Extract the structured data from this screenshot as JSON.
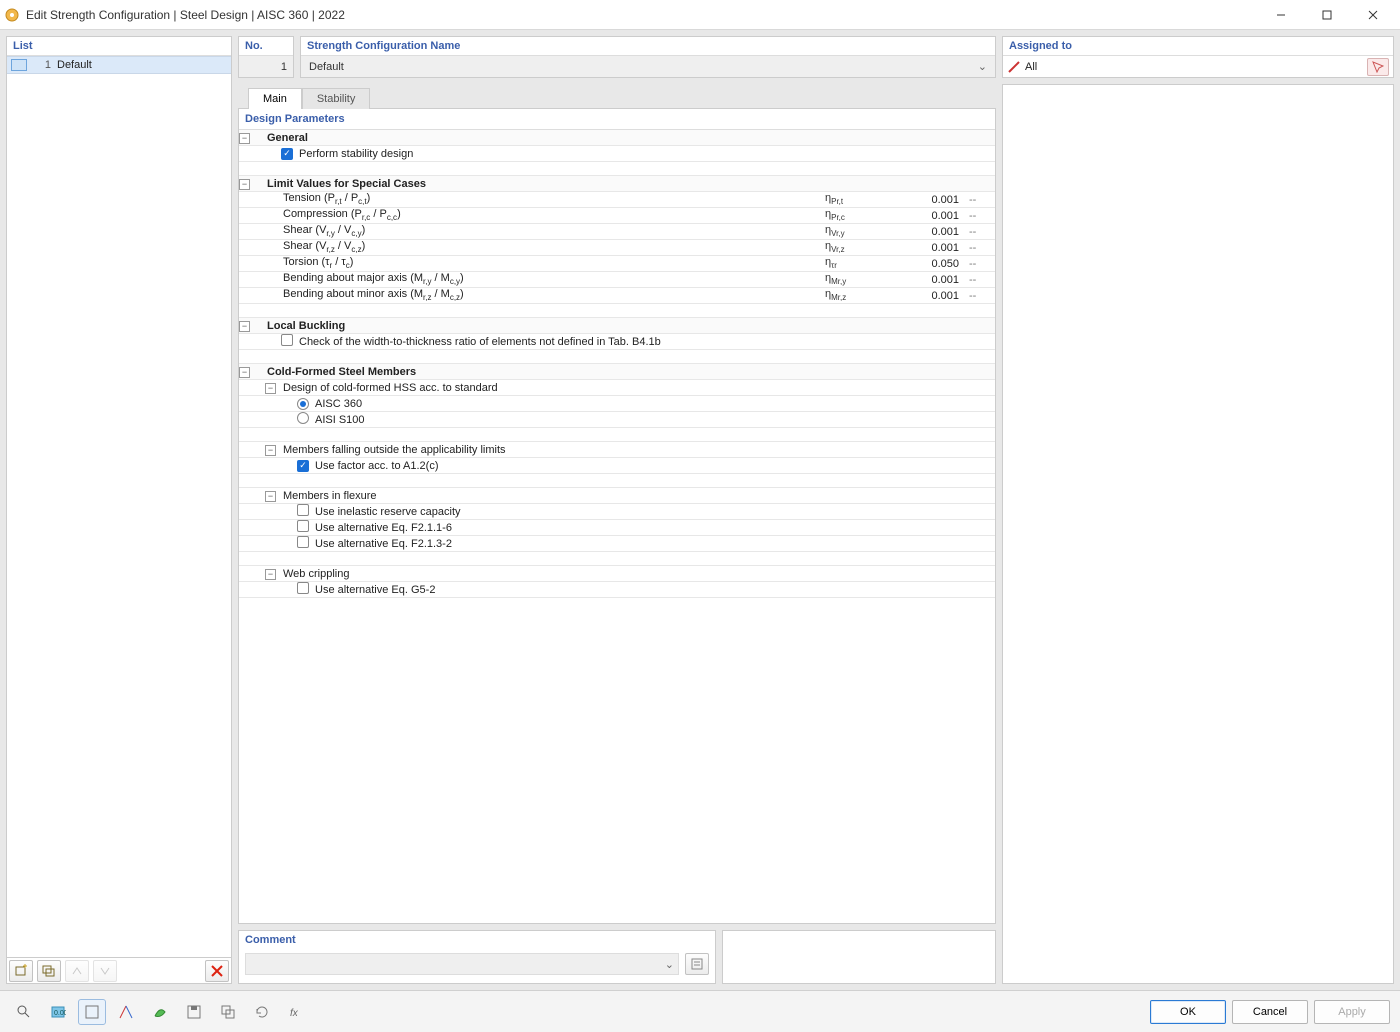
{
  "window": {
    "title": "Edit Strength Configuration | Steel Design | AISC 360 | 2022"
  },
  "left": {
    "header": "List",
    "item_no": "1",
    "item_name": "Default"
  },
  "top": {
    "no_label": "No.",
    "no_value": "1",
    "name_label": "Strength Configuration Name",
    "name_value": "Default",
    "assigned_label": "Assigned to",
    "assigned_value": "All"
  },
  "tabs": {
    "main": "Main",
    "stability": "Stability"
  },
  "params": {
    "title": "Design Parameters",
    "general": "General",
    "perform_stability": "Perform stability design",
    "limit_values": "Limit Values for Special Cases",
    "rows": [
      {
        "name": "Tension (P<sub>r,t</sub> / P<sub>c,t</sub>)",
        "sym": "η<sub>Pr,t</sub>",
        "val": "0.001",
        "unit": "--"
      },
      {
        "name": "Compression (P<sub>r,c</sub> / P<sub>c,c</sub>)",
        "sym": "η<sub>Pr,c</sub>",
        "val": "0.001",
        "unit": "--"
      },
      {
        "name": "Shear (V<sub>r,y</sub> / V<sub>c,y</sub>)",
        "sym": "η<sub>Vr,y</sub>",
        "val": "0.001",
        "unit": "--"
      },
      {
        "name": "Shear (V<sub>r,z</sub> / V<sub>c,z</sub>)",
        "sym": "η<sub>Vr,z</sub>",
        "val": "0.001",
        "unit": "--"
      },
      {
        "name": "Torsion (τ<sub>r</sub> / τ<sub>c</sub>)",
        "sym": "η<sub>τr</sub>",
        "val": "0.050",
        "unit": "--"
      },
      {
        "name": "Bending about major axis (M<sub>r,y</sub> / M<sub>c,y</sub>)",
        "sym": "η<sub>Mr,y</sub>",
        "val": "0.001",
        "unit": "--"
      },
      {
        "name": "Bending about minor axis (M<sub>r,z</sub> / M<sub>c,z</sub>)",
        "sym": "η<sub>Mr,z</sub>",
        "val": "0.001",
        "unit": "--"
      }
    ],
    "local_buckling": "Local Buckling",
    "local_buckling_check": "Check of the width-to-thickness ratio of elements not defined in Tab. B4.1b",
    "cold_formed": "Cold-Formed Steel Members",
    "design_hss": "Design of cold-formed HSS acc. to standard",
    "aisc360": "AISC 360",
    "aisis100": "AISI S100",
    "falling_outside": "Members falling outside the applicability limits",
    "use_factor": "Use factor acc. to A1.2(c)",
    "members_flexure": "Members in flexure",
    "inelastic": "Use inelastic reserve capacity",
    "alt1": "Use alternative Eq. F2.1.1-6",
    "alt2": "Use alternative Eq. F2.1.3-2",
    "web_crippling": "Web crippling",
    "alt_g52": "Use alternative Eq. G5-2"
  },
  "comment": {
    "label": "Comment"
  },
  "footer": {
    "ok": "OK",
    "cancel": "Cancel",
    "apply": "Apply"
  }
}
